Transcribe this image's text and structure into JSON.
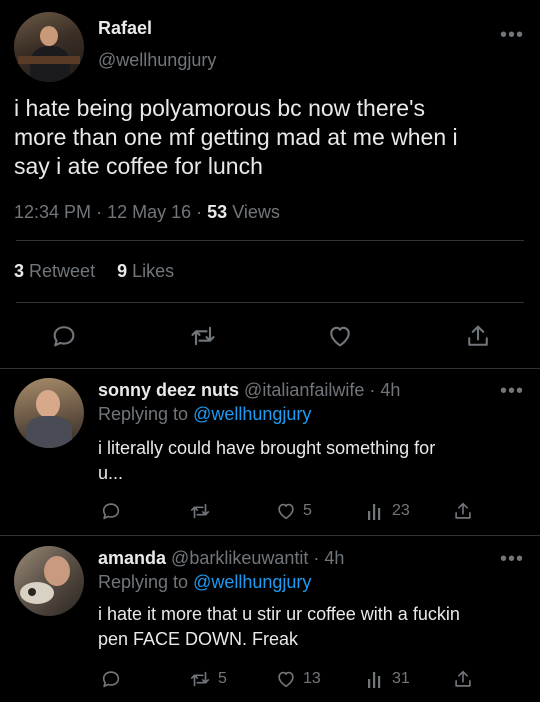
{
  "main_tweet": {
    "author_name": "Rafael",
    "author_handle": "@wellhungjury",
    "text_lines": [
      "i hate being polyamorous bc now there's",
      "more than one mf getting mad at me when i",
      "say i ate coffee for lunch"
    ],
    "time": "12:34 PM",
    "date": "12 May 16",
    "views_count": "53",
    "views_label": "Views",
    "retweet_count": "3",
    "retweet_label": "Retweet",
    "likes_count": "9",
    "likes_label": "Likes",
    "separator": "·"
  },
  "replies": [
    {
      "author_name": "sonny deez nuts",
      "author_handle": "@italianfailwife",
      "time": "· 4h",
      "replying_prefix": "Replying to",
      "replying_handle": "@wellhungjury",
      "text_lines": [
        "i literally could have brought something for",
        "u..."
      ],
      "retweets": "",
      "likes": "5",
      "views": "23"
    },
    {
      "author_name": "amanda",
      "author_handle": "@barklikeuwantit",
      "time": "· 4h",
      "replying_prefix": "Replying to",
      "replying_handle": "@wellhungjury",
      "text_lines": [
        "i hate it more that u stir ur coffee with a fuckin",
        "pen FACE DOWN. Freak"
      ],
      "retweets": "5",
      "likes": "13",
      "views": "31"
    }
  ],
  "more_glyph": "•••",
  "colors": {
    "background": "#000000",
    "text": "#e7e9ea",
    "muted": "#71767b",
    "link": "#1d9bf0",
    "divider": "#2f3336"
  },
  "icons": [
    "reply-icon",
    "retweet-icon",
    "like-icon",
    "share-icon",
    "views-icon",
    "more-icon"
  ]
}
